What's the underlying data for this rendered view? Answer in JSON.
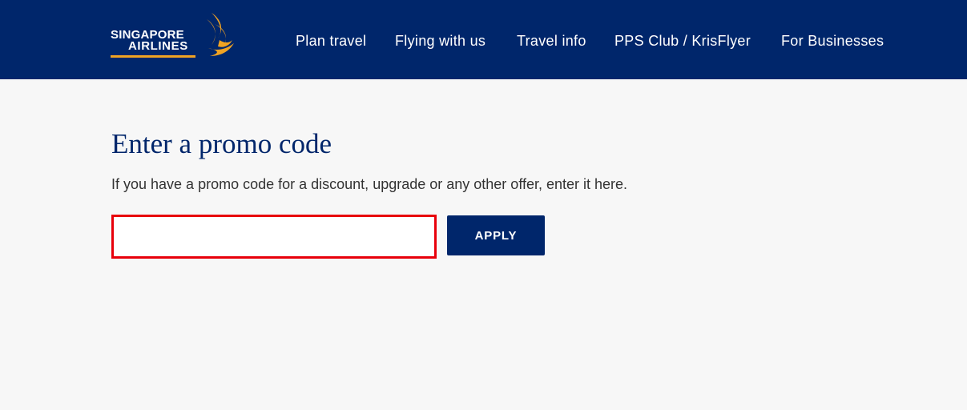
{
  "header": {
    "background_color": "#00266b",
    "logo": {
      "line1": "SINGAPORE",
      "line2": "AIRLINES",
      "accent_color": "#f0a323",
      "icon": "singapore-airlines-bird-icon"
    },
    "nav": [
      {
        "label": "Plan travel"
      },
      {
        "label": "Flying with us"
      },
      {
        "label": "Travel info"
      },
      {
        "label": "PPS Club / KrisFlyer"
      },
      {
        "label": "For Businesses"
      }
    ]
  },
  "main": {
    "title": "Enter a promo code",
    "description": "If you have a promo code for a discount, upgrade or any other offer, enter it here.",
    "promo_input": {
      "value": "",
      "placeholder": "",
      "highlight_border_color": "#e8000b"
    },
    "apply_label": "APPLY"
  }
}
